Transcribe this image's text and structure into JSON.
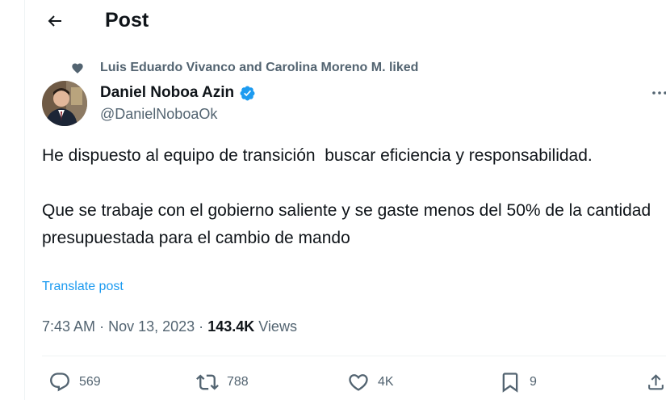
{
  "header": {
    "title": "Post",
    "back_icon": "arrow-left-icon"
  },
  "social_context": {
    "icon": "heart-icon",
    "text": "Luis Eduardo Vivanco and Carolina Moreno M. liked"
  },
  "author": {
    "name": "Daniel Noboa Azin",
    "handle": "@DanielNoboaOk",
    "verified": true,
    "verified_color": "#1d9bf0"
  },
  "post": {
    "paragraphs": [
      "He dispuesto al equipo de transición  buscar eficiencia y responsabilidad.",
      "Que se trabaje con el gobierno saliente y se gaste menos del 50% de la cantidad presupuestada para el cambio de mando"
    ],
    "translate_label": "Translate post"
  },
  "meta": {
    "time": "7:43 AM",
    "separator": "·",
    "date": "Nov 13, 2023",
    "views_count": "143.4K",
    "views_label": "Views"
  },
  "actions": {
    "replies": "569",
    "reposts": "788",
    "likes": "4K",
    "bookmarks": "9"
  },
  "colors": {
    "text": "#0f1419",
    "secondary": "#536471",
    "link": "#1d9bf0",
    "divider": "#eff3f4"
  }
}
